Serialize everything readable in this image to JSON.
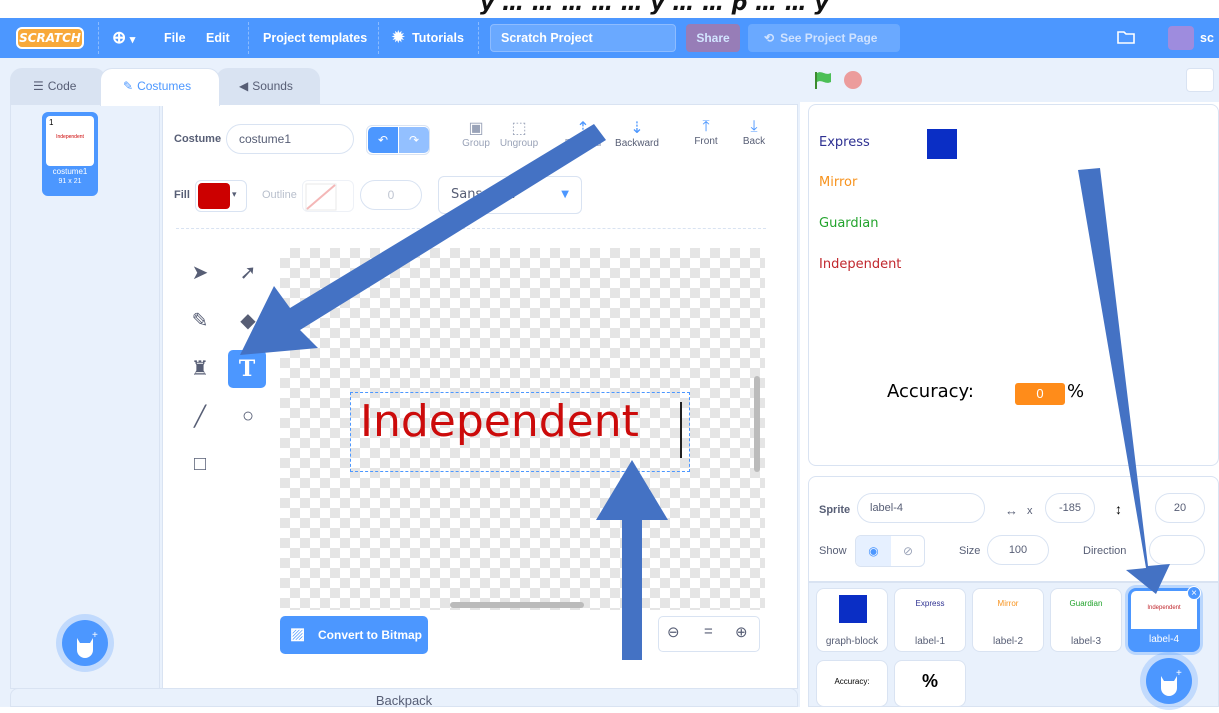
{
  "title_strip": "y … … … … … y … … p … … y",
  "menubar": {
    "logo": "SCRATCH",
    "globe_menu": "▾",
    "file": "File",
    "edit": "Edit",
    "project_templates": "Project templates",
    "tutorials": "Tutorials",
    "project_title": "Scratch Project",
    "share": "Share",
    "see_project_page": "See Project Page",
    "username": "sc"
  },
  "tabs": {
    "code": "Code",
    "costumes": "Costumes",
    "sounds": "Sounds"
  },
  "costume_list": {
    "items": [
      {
        "index": "1",
        "preview": "Independent",
        "name": "costume1",
        "size": "91 x 21"
      }
    ]
  },
  "paint_editor": {
    "costume_label": "Costume",
    "costume_name": "costume1",
    "group": "Group",
    "ungroup": "Ungroup",
    "forward": "Forward",
    "backward": "Backward",
    "front": "Front",
    "back": "Back",
    "fill_label": "Fill",
    "fill_color": "#cc0000",
    "outline_label": "Outline",
    "outline_width": "0",
    "font": "Sans Serif",
    "canvas_text": "Independent",
    "canvas_text_color": "#cc0b0b",
    "convert_button": "Convert to Bitmap",
    "zoom_reset": "="
  },
  "stage": {
    "labels": [
      {
        "text": "Express",
        "color": "#2e3192"
      },
      {
        "text": "Mirror",
        "color": "#f7931e"
      },
      {
        "text": "Guardian",
        "color": "#22a32c"
      },
      {
        "text": "Independent",
        "color": "#c1272d"
      }
    ],
    "block_color": "#0a2ec5",
    "accuracy_label": "Accuracy:",
    "accuracy_value": "0",
    "percent": "%"
  },
  "sprite_info": {
    "sprite_label": "Sprite",
    "sprite_name": "label-4",
    "x_label": "x",
    "x_value": "-185",
    "y_value": "20",
    "show_label": "Show",
    "size_label": "Size",
    "size_value": "100",
    "direction_label": "Direction"
  },
  "sprites": [
    {
      "name": "graph-block",
      "preview": ""
    },
    {
      "name": "label-1",
      "preview": "Express"
    },
    {
      "name": "label-2",
      "preview": "Mirror"
    },
    {
      "name": "label-3",
      "preview": "Guardian"
    },
    {
      "name": "label-4",
      "preview": "Independent"
    },
    {
      "name": "",
      "preview": "Accuracy:"
    },
    {
      "name": "",
      "preview": "%"
    }
  ],
  "backpack": "Backpack",
  "annotation_color": "#4472c4"
}
